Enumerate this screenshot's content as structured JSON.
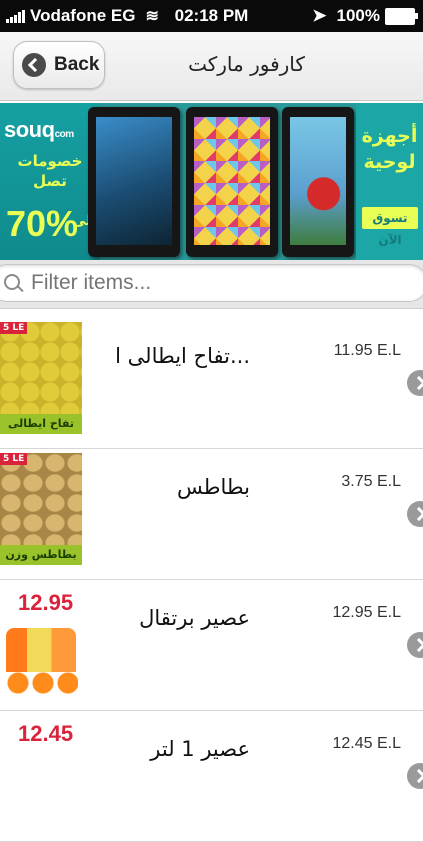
{
  "status_bar": {
    "carrier": "Vodafone EG",
    "time": "02:18 PM",
    "battery": "100%",
    "icons": [
      "signal-icon",
      "wifi-icon",
      "location-arrow-icon",
      "battery-icon"
    ]
  },
  "nav": {
    "back_label": "Back",
    "title": "كارفور ماركت"
  },
  "banner": {
    "brand": "souq",
    "brand_suffix": "com",
    "promo_text": "خصومات تصل",
    "discount": "70%",
    "discount_prefix": "الى",
    "headline_line1": "أجهزة",
    "headline_line2": "لوحية",
    "cta": "تسوق الآن",
    "colors": {
      "teal": "#1da6a6",
      "accent": "#eaff55"
    }
  },
  "search": {
    "placeholder": "Filter items..."
  },
  "items": [
    {
      "name": "...تفاح ايطالى ا",
      "price": "11.95 E.L",
      "thumb_label": "تفاح ايطالى اصفر",
      "thumb_tag": "5 LE"
    },
    {
      "name": "بطاطس",
      "price": "3.75 E.L",
      "thumb_label": "بطاطس وزن",
      "thumb_tag": "5 LE"
    },
    {
      "name": "عصير برتقال",
      "price": "12.95 E.L",
      "thumb_price": "12.95"
    },
    {
      "name": "عصير 1 لتر",
      "price": "12.45 E.L",
      "thumb_price": "12.45"
    }
  ]
}
